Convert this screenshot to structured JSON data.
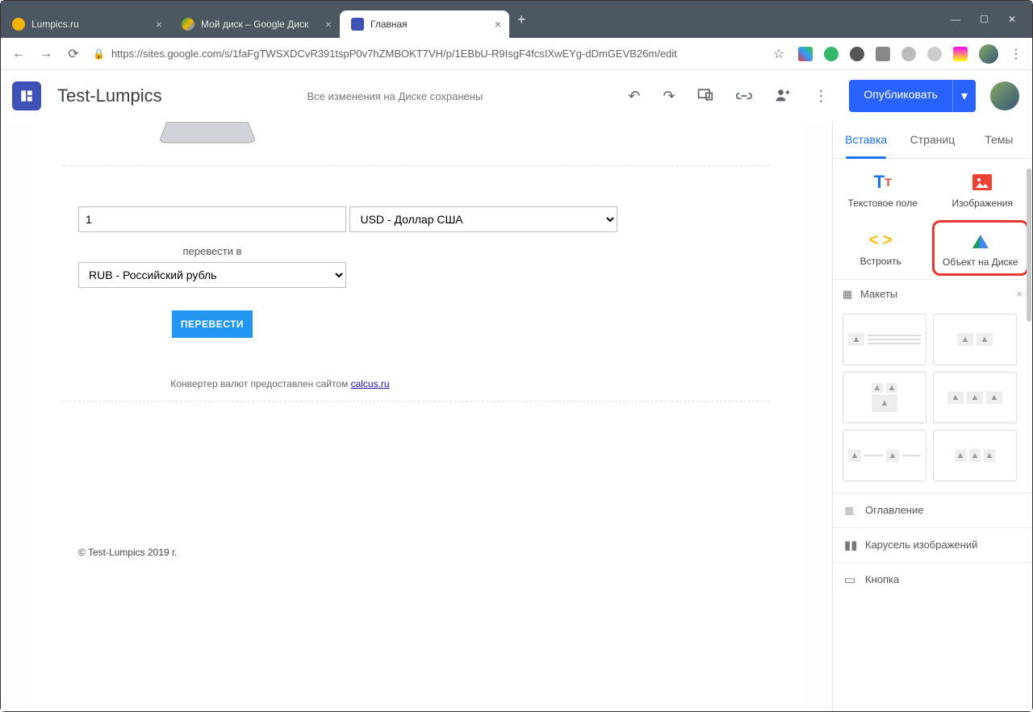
{
  "tabs": [
    {
      "label": "Lumpics.ru",
      "favcolor": "#f4b400"
    },
    {
      "label": "Мой диск – Google Диск",
      "favcolor": "#0f9d58"
    },
    {
      "label": "Главная",
      "favcolor": "#3f51b5",
      "active": true
    }
  ],
  "url": "https://sites.google.com/s/1faFgTWSXDCvR391tspP0v7hZMBOKT7VH/p/1EBbU-R9IsgF4fcsIXwEYg-dDmGEVB26m/edit",
  "site": {
    "name": "Test-Lumpics",
    "saved": "Все изменения на Диске сохранены",
    "publish": "Опубликовать"
  },
  "converter": {
    "amount": "1",
    "from": "USD - Доллар США",
    "tolabel": "перевести в",
    "to": "RUB - Российский рубль",
    "button": "ПЕРЕВЕСТИ",
    "credit_text": "Конвертер валют предоставлен сайтом ",
    "credit_link": "calcus.ru"
  },
  "footer": "© Test-Lumpics 2019 г.",
  "rpanel": {
    "tabs": [
      "Вставка",
      "Страниц",
      "Темы"
    ],
    "items": {
      "text": "Текстовое поле",
      "images": "Изображения",
      "embed": "Встроить",
      "drive": "Объект на Диске"
    },
    "layouts": "Макеты",
    "more": {
      "toc": "Оглавление",
      "carousel": "Карусель изображений",
      "button": "Кнопка"
    }
  }
}
